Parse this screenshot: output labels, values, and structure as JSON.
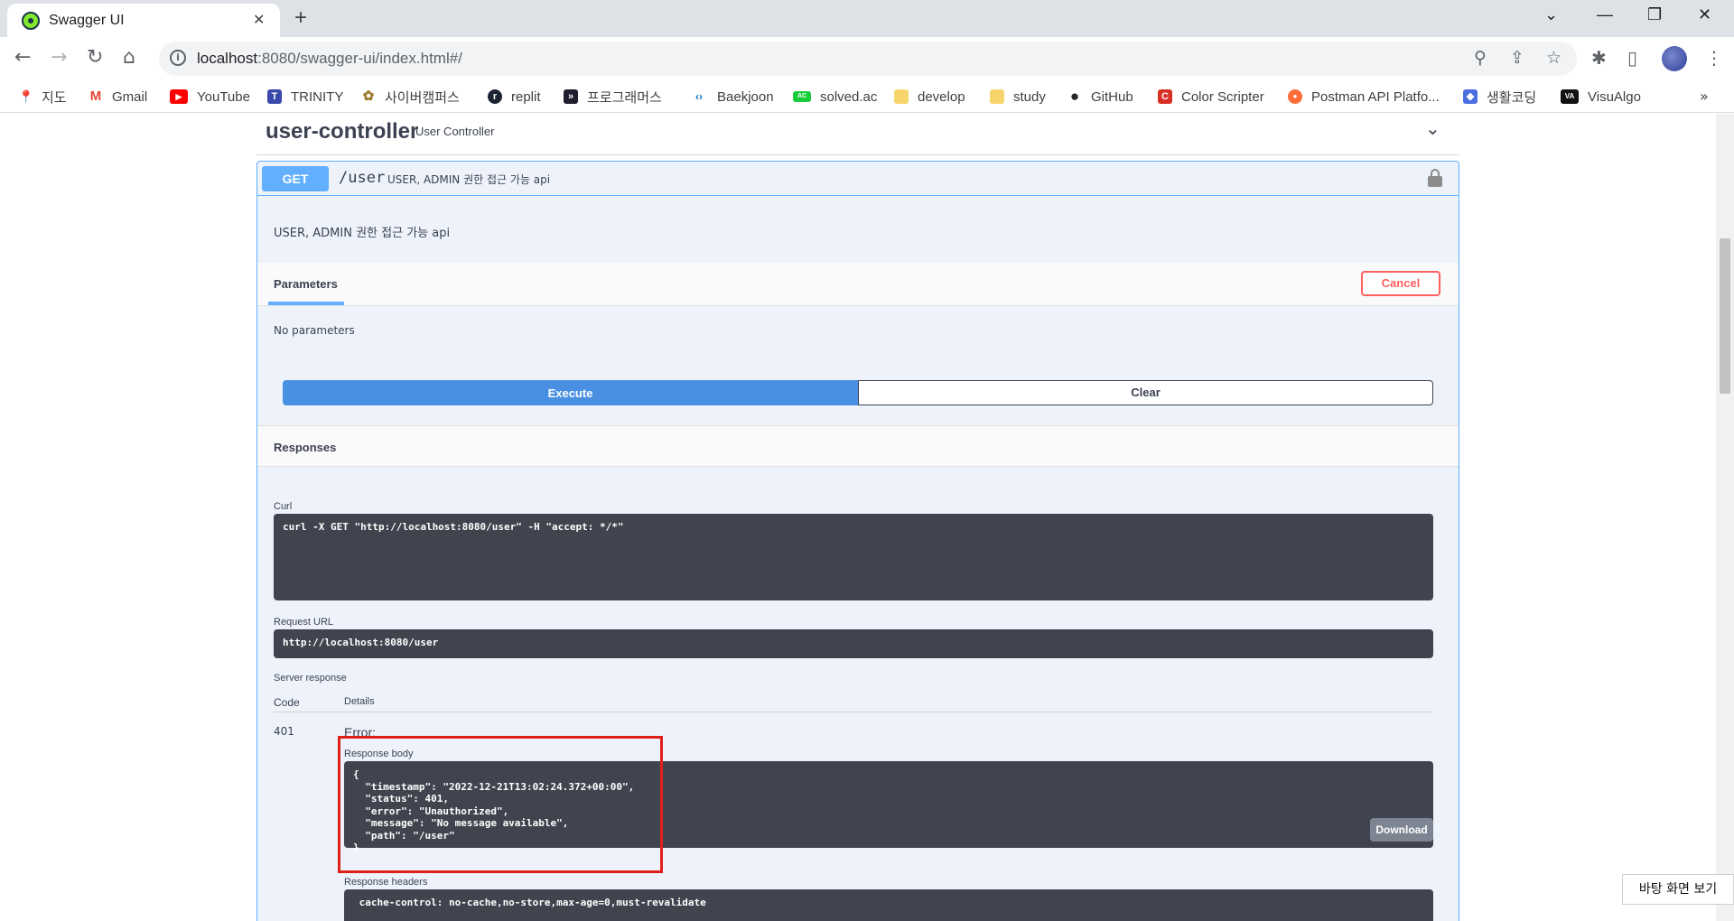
{
  "browser": {
    "tab_title": "Swagger UI",
    "tab_close": "✕",
    "new_tab": "+",
    "url_host": "localhost",
    "url_path": ":8080/swagger-ui/index.html#/",
    "icons": {
      "back": "←",
      "forward": "→",
      "reload": "↻",
      "home": "⌂",
      "info": "i",
      "zoom": "⚲",
      "share": "⇪",
      "star": "☆",
      "extensions": "✱",
      "sidepanel": "▯",
      "menu": "⋮",
      "minimize": "⌄",
      "min": "—",
      "restore": "❐",
      "close": "✕"
    }
  },
  "bookmarks": {
    "items": [
      {
        "label": "지도",
        "icon": "📍",
        "color": "#34a853"
      },
      {
        "label": "Gmail",
        "icon": "M",
        "color": "#ea4335"
      },
      {
        "label": "YouTube",
        "icon": "▶",
        "color": "#ff0000"
      },
      {
        "label": "TRINITY",
        "icon": "T",
        "color": "#3949ab"
      },
      {
        "label": "사이버캠퍼스",
        "icon": "✿",
        "color": "#9c7b2f"
      },
      {
        "label": "replit",
        "icon": "r",
        "color": "#1c2333"
      },
      {
        "label": "프로그래머스",
        "icon": "»",
        "color": "#1e1e2f"
      },
      {
        "label": "Baekjoon",
        "icon": "‹›",
        "color": "#0076c0"
      },
      {
        "label": "solved.ac",
        "icon": "AC",
        "color": "#17ce3a"
      },
      {
        "label": "develop",
        "icon": "",
        "color": "#f6d66b"
      },
      {
        "label": "study",
        "icon": "",
        "color": "#f6d66b"
      },
      {
        "label": "GitHub",
        "icon": "●",
        "color": "#24292e"
      },
      {
        "label": "Color Scripter",
        "icon": "C",
        "color": "#d93025"
      },
      {
        "label": "Postman API Platfo...",
        "icon": "●",
        "color": "#ff6c37"
      },
      {
        "label": "생활코딩",
        "icon": "◆",
        "color": "#4a6ee0"
      },
      {
        "label": "VisuAlgo",
        "icon": "VA",
        "color": "#111111"
      }
    ],
    "more": "»"
  },
  "tag": {
    "name": "user-controller",
    "description": "User Controller",
    "chevron": "⌄"
  },
  "operation": {
    "method": "GET",
    "path": "/user",
    "summary": "USER, ADMIN 권한 접근 가능 api",
    "description": "USER, ADMIN 권한 접근 가능 api",
    "parameters_tab": "Parameters",
    "cancel_label": "Cancel",
    "no_parameters": "No parameters",
    "execute_label": "Execute",
    "clear_label": "Clear"
  },
  "responses": {
    "title": "Responses",
    "curl_label": "Curl",
    "curl_command": "curl -X GET \"http://localhost:8080/user\" -H \"accept: */*\"",
    "request_url_label": "Request URL",
    "request_url": "http://localhost:8080/user",
    "server_response_label": "Server response",
    "code_header": "Code",
    "details_header": "Details",
    "status_code": "401",
    "error_text": "Error:",
    "response_body_label": "Response body",
    "response_body": "{\n  \"timestamp\": \"2022-12-21T13:02:24.372+00:00\",\n  \"status\": 401,\n  \"error\": \"Unauthorized\",\n  \"message\": \"No message available\",\n  \"path\": \"/user\"\n}",
    "download_label": "Download",
    "response_headers_label": "Response headers",
    "response_headers": " cache-control: no-cache,no-store,max-age=0,must-revalidate"
  },
  "os": {
    "tooltip": "바탕 화면 보기"
  }
}
